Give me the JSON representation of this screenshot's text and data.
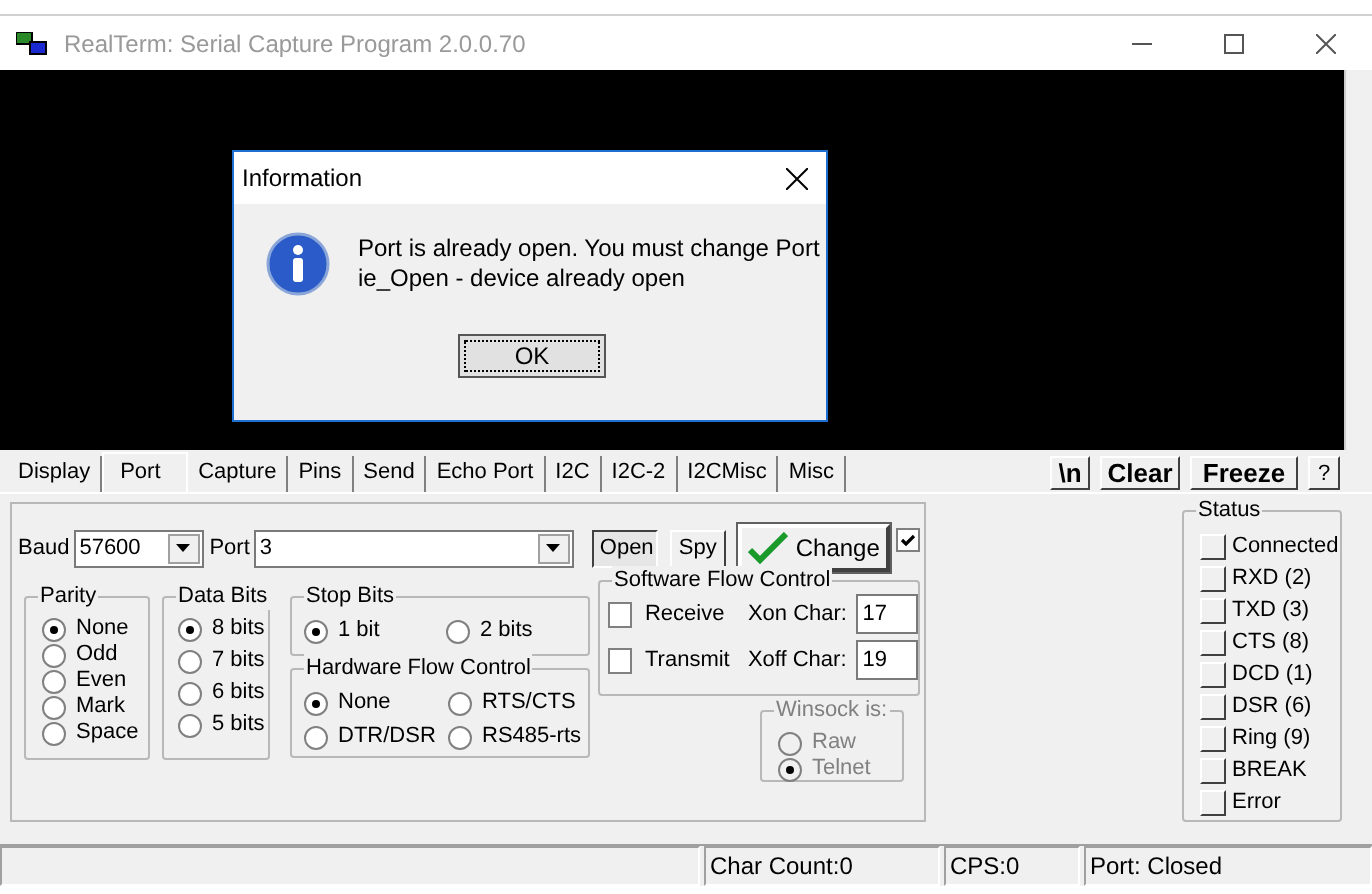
{
  "window": {
    "title": "RealTerm: Serial Capture Program 2.0.0.70"
  },
  "dialog": {
    "title": "Information",
    "message_lines": [
      "Port is already open. You must change Port",
      "ie_Open - device already open"
    ],
    "button": "OK"
  },
  "tabs": [
    {
      "label": "Display",
      "selected": false
    },
    {
      "label": "Port",
      "selected": true
    },
    {
      "label": "Capture",
      "selected": false
    },
    {
      "label": "Pins",
      "selected": false
    },
    {
      "label": "Send",
      "selected": false
    },
    {
      "label": "Echo Port",
      "selected": false
    },
    {
      "label": "I2C",
      "selected": false
    },
    {
      "label": "I2C-2",
      "selected": false
    },
    {
      "label": "I2CMisc",
      "selected": false
    },
    {
      "label": "Misc",
      "selected": false
    }
  ],
  "toolbar_buttons": [
    "\\n",
    "Clear",
    "Freeze",
    "?"
  ],
  "port": {
    "baud": {
      "label": "Baud",
      "value": "57600"
    },
    "port": {
      "label": "Port",
      "value": "3"
    },
    "open_button": {
      "label": "Open",
      "pressed": true
    },
    "spy_button": {
      "label": "Spy",
      "pressed": false
    },
    "change_button": {
      "label": "Change"
    },
    "change_checkbox": {
      "checked": true
    },
    "parity": {
      "title": "Parity",
      "options": [
        {
          "label": "None",
          "selected": true
        },
        {
          "label": "Odd",
          "selected": false
        },
        {
          "label": "Even",
          "selected": false
        },
        {
          "label": "Mark",
          "selected": false
        },
        {
          "label": "Space",
          "selected": false
        }
      ]
    },
    "data_bits": {
      "title": "Data Bits",
      "options": [
        {
          "label": "8 bits",
          "selected": true
        },
        {
          "label": "7 bits",
          "selected": false
        },
        {
          "label": "6 bits",
          "selected": false
        },
        {
          "label": "5 bits",
          "selected": false
        }
      ]
    },
    "stop_bits": {
      "title": "Stop Bits",
      "options": [
        {
          "label": "1 bit",
          "selected": true
        },
        {
          "label": "2 bits",
          "selected": false
        }
      ]
    },
    "hardware_flow": {
      "title": "Hardware Flow Control",
      "options": [
        {
          "label": "None",
          "selected": true
        },
        {
          "label": "RTS/CTS",
          "selected": false
        },
        {
          "label": "DTR/DSR",
          "selected": false
        },
        {
          "label": "RS485-rts",
          "selected": false
        }
      ]
    },
    "software_flow": {
      "title": "Software Flow Control",
      "rows": [
        {
          "label": "Receive",
          "checked": false,
          "char_label": "Xon Char:",
          "value": "17"
        },
        {
          "label": "Transmit",
          "checked": false,
          "char_label": "Xoff Char:",
          "value": "19"
        }
      ]
    },
    "winsock": {
      "title": "Winsock is:",
      "disabled": true,
      "options": [
        {
          "label": "Raw",
          "selected": false
        },
        {
          "label": "Telnet",
          "selected": true
        }
      ]
    }
  },
  "status": {
    "title": "Status",
    "items": [
      {
        "label": "Connected",
        "on": false
      },
      {
        "label": "RXD (2)",
        "on": false
      },
      {
        "label": "TXD (3)",
        "on": false
      },
      {
        "label": "CTS (8)",
        "on": false
      },
      {
        "label": "DCD (1)",
        "on": false
      },
      {
        "label": "DSR (6)",
        "on": false
      },
      {
        "label": "Ring (9)",
        "on": false
      },
      {
        "label": "BREAK",
        "on": false
      },
      {
        "label": "Error",
        "on": false
      }
    ]
  },
  "status_bar": [
    "Char Count:0",
    "CPS:0",
    "Port: Closed"
  ]
}
